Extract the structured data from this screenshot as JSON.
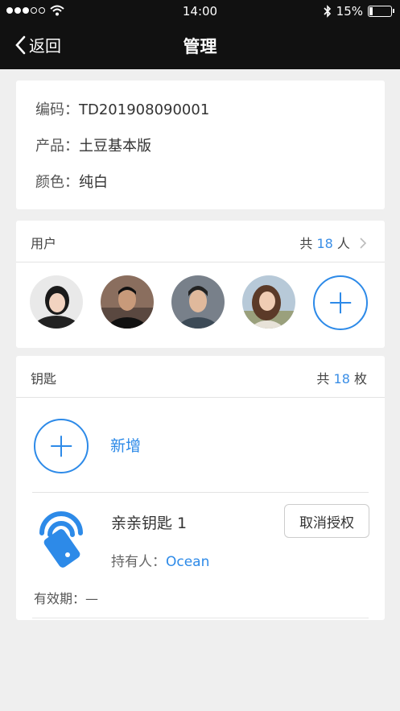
{
  "status_bar": {
    "time": "14:00",
    "battery": "15%",
    "battery_level": 0.15
  },
  "nav": {
    "back_label": "返回",
    "title": "管理"
  },
  "info": {
    "code_label": "编码：",
    "code_value": "TD201908090001",
    "product_label": "产品：",
    "product_value": "土豆基本版",
    "color_label": "颜色：",
    "color_value": "纯白"
  },
  "users": {
    "title": "用户",
    "count_prefix": "共",
    "count": "18",
    "count_suffix": "人"
  },
  "keys": {
    "title": "钥匙",
    "count_prefix": "共",
    "count": "18",
    "count_suffix": "枚",
    "add_label": "新增",
    "items": [
      {
        "name": "亲亲钥匙 1",
        "revoke_label": "取消授权",
        "holder_label": "持有人：",
        "holder_name": "Ocean",
        "validity_label": "有效期：",
        "validity_value": "—"
      }
    ]
  },
  "colors": {
    "accent": "#2d8ae8",
    "bar": "#111111",
    "background": "#efefef"
  },
  "icons": {
    "back": "chevron-left-icon",
    "wifi": "wifi-icon",
    "bluetooth": "bluetooth-icon",
    "add": "plus-circle-icon",
    "more": "chevron-right-icon",
    "key": "nfc-key-icon"
  }
}
